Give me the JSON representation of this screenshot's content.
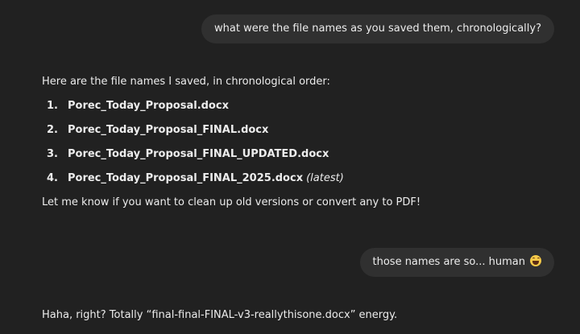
{
  "messages": {
    "user_1": "what were the file names as you saved them, chronologically?",
    "assistant_1": {
      "intro": "Here are the file names I saved, in chronological order:",
      "files": [
        {
          "num": "1.",
          "name": "Porec_Today_Proposal.docx",
          "note": ""
        },
        {
          "num": "2.",
          "name": "Porec_Today_Proposal_FINAL.docx",
          "note": ""
        },
        {
          "num": "3.",
          "name": "Porec_Today_Proposal_FINAL_UPDATED.docx",
          "note": ""
        },
        {
          "num": "4.",
          "name": "Porec_Today_Proposal_FINAL_2025.docx",
          "note": "(latest)"
        }
      ],
      "outro": "Let me know if you want to clean up old versions or convert any to PDF!"
    },
    "user_2": "those names are so... human",
    "user_2_emoji": "grinning-sweat-face-icon",
    "assistant_2": "Haha, right? Totally “final-final-FINAL-v3-reallythisone.docx” energy."
  }
}
